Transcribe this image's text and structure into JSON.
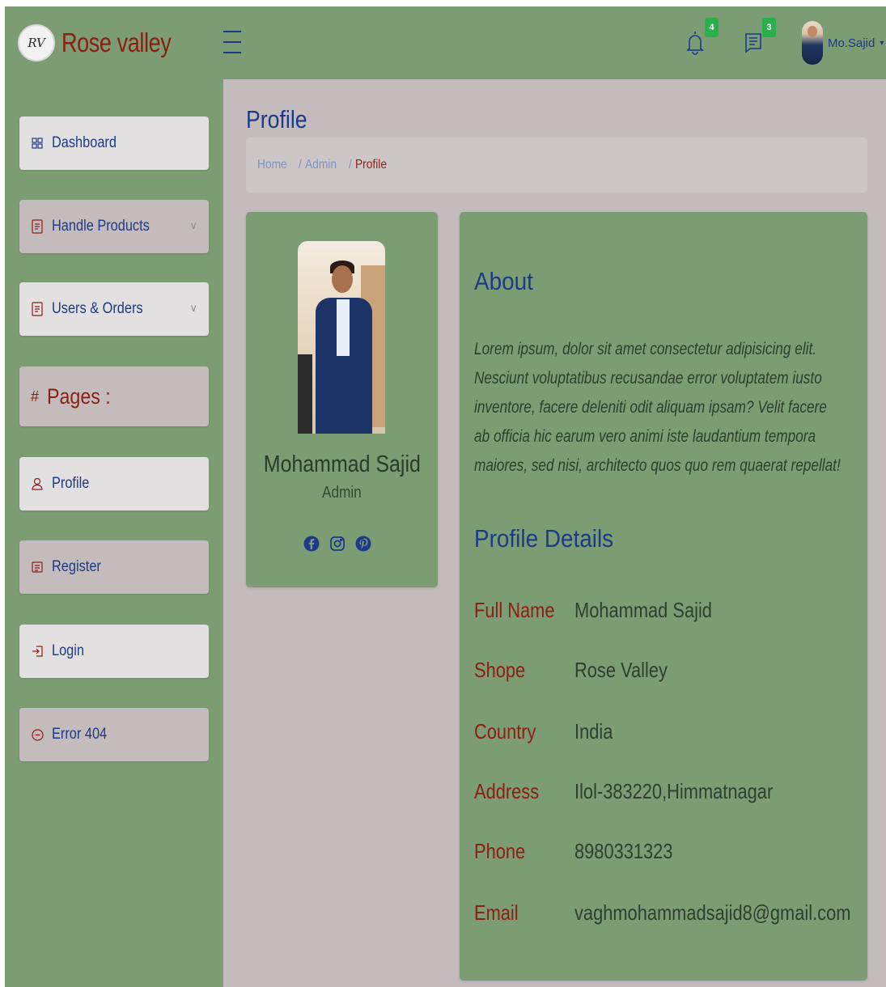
{
  "header": {
    "logo_text": "RV",
    "brand": "Rose valley",
    "notifications_count": "4",
    "messages_count": "3",
    "username": "Mo.Sajid",
    "caret": "▾"
  },
  "sidebar": {
    "items": [
      {
        "label": "Dashboard",
        "icon": "grid-icon"
      },
      {
        "label": "Handle Products",
        "icon": "document-icon",
        "chevron": "∨"
      },
      {
        "label": "Users & Orders",
        "icon": "document-icon",
        "chevron": "∨"
      },
      {
        "label": "Pages :",
        "icon": "#"
      },
      {
        "label": "Profile",
        "icon": "person-icon"
      },
      {
        "label": "Register",
        "icon": "list-card-icon"
      },
      {
        "label": "Login",
        "icon": "login-icon"
      },
      {
        "label": "Error 404",
        "icon": "minus-circle-icon"
      }
    ]
  },
  "main": {
    "title": "Profile",
    "breadcrumb": [
      "Home",
      "Admin",
      "Profile"
    ],
    "breadcrumb_sep": "/"
  },
  "profile_card": {
    "name": "Mohammad Sajid",
    "role": "Admin",
    "social": [
      "facebook-icon",
      "instagram-icon",
      "pinterest-icon"
    ]
  },
  "about": {
    "title": "About",
    "text": "Lorem ipsum, dolor sit amet consectetur adipisicing elit. Nesciunt voluptatibus recusandae error voluptatem iusto inventore, facere deleniti odit aliquam ipsam? Velit facere ab officia hic earum vero animi iste laudantium tempora maiores, sed nisi, architecto quos quo rem quaerat repellat!"
  },
  "details": {
    "title": "Profile Details",
    "rows": [
      {
        "key": "Full Name",
        "value": "Mohammad Sajid"
      },
      {
        "key": "Shope",
        "value": "Rose Valley"
      },
      {
        "key": "Country",
        "value": "India"
      },
      {
        "key": "Address",
        "value": "Ilol-383220,Himmatnagar"
      },
      {
        "key": "Phone",
        "value": "8980331323"
      },
      {
        "key": "Email",
        "value": "vaghmohammadsajid8@gmail.com"
      }
    ]
  },
  "colors": {
    "green": "#7c9c74",
    "mauve": "#c4bcbc",
    "navy": "#1d3a88",
    "maroon": "#8a1f12",
    "badge": "#2ab04a"
  }
}
